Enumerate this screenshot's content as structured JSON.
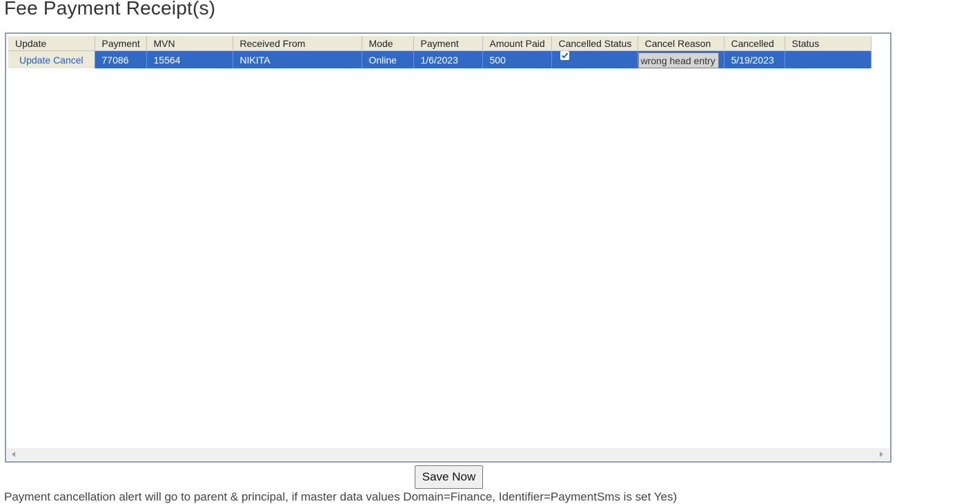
{
  "page": {
    "title": "Fee Payment Receipt(s)"
  },
  "grid": {
    "columns": [
      "Update",
      "Payment",
      "MVN",
      "Received From",
      "Mode",
      "Payment",
      "Amount Paid",
      "Cancelled Status",
      "Cancel Reason",
      "Cancelled",
      "Status"
    ],
    "row": {
      "update_label": "Update",
      "cancel_label": "Cancel",
      "payment_no": "77086",
      "mvn": "15564",
      "received_from": "NIKITA",
      "mode": "Online",
      "payment_date": "1/6/2023",
      "amount_paid": "500",
      "cancelled_status": true,
      "cancel_reason": "wrong head entry",
      "cancelled_date": "5/19/2023",
      "status": ""
    },
    "colors": {
      "selected_row": "#316ac5",
      "header_bg": "#ece9d8",
      "link": "#1a5fd6"
    }
  },
  "actions": {
    "save_label": "Save Now"
  },
  "footer": {
    "note": "Payment cancellation alert will go to parent & principal, if master data values Domain=Finance, Identifier=PaymentSms is set Yes)"
  }
}
